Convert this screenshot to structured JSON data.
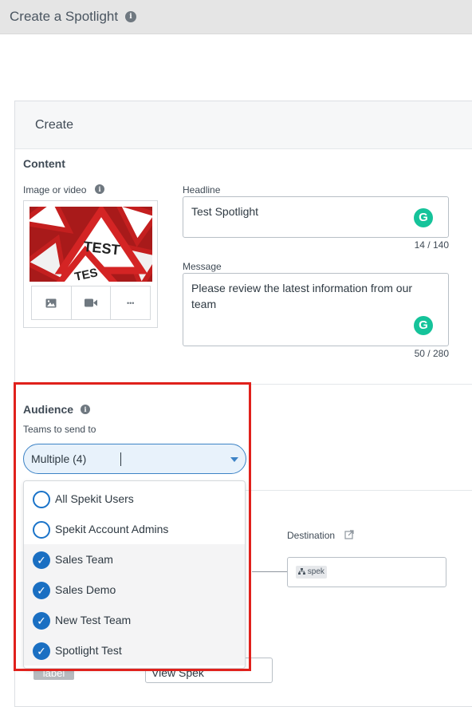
{
  "header": {
    "title": "Create a Spotlight",
    "info_icon": "info-icon"
  },
  "panel": {
    "title": "Create"
  },
  "content": {
    "section_label": "Content",
    "media": {
      "label": "Image or video",
      "image_text_top": "TEST",
      "image_text_bottom": "TES",
      "buttons": [
        {
          "icon": "image-icon"
        },
        {
          "icon": "video-camera-icon"
        },
        {
          "icon": "more-icon",
          "glyph": "•••"
        }
      ]
    },
    "headline": {
      "label": "Headline",
      "value": "Test Spotlight",
      "counter": "14 / 140"
    },
    "message": {
      "label": "Message",
      "value": "Please review the latest information from our team",
      "counter": "50 / 280"
    },
    "grammarly_glyph": "G"
  },
  "audience": {
    "section_label": "Audience",
    "teams_label": "Teams to send to",
    "selected_value": "Multiple (4)",
    "options": [
      {
        "label": "All Spekit Users",
        "checked": false
      },
      {
        "label": "Spekit Account Admins",
        "checked": false
      },
      {
        "label": "Sales Team",
        "checked": true
      },
      {
        "label": "Sales Demo",
        "checked": true
      },
      {
        "label": "New Test Team",
        "checked": true
      },
      {
        "label": "Spotlight Test",
        "checked": true
      }
    ],
    "check_glyph": "✓"
  },
  "action": {
    "destination_label": "Destination",
    "destination_chip": "spek",
    "label_chip": "label",
    "button_text_value": "View Spek"
  },
  "colors": {
    "accent": "#1a6fc2",
    "highlight_border": "#e0211c",
    "grammarly": "#15c39a"
  }
}
